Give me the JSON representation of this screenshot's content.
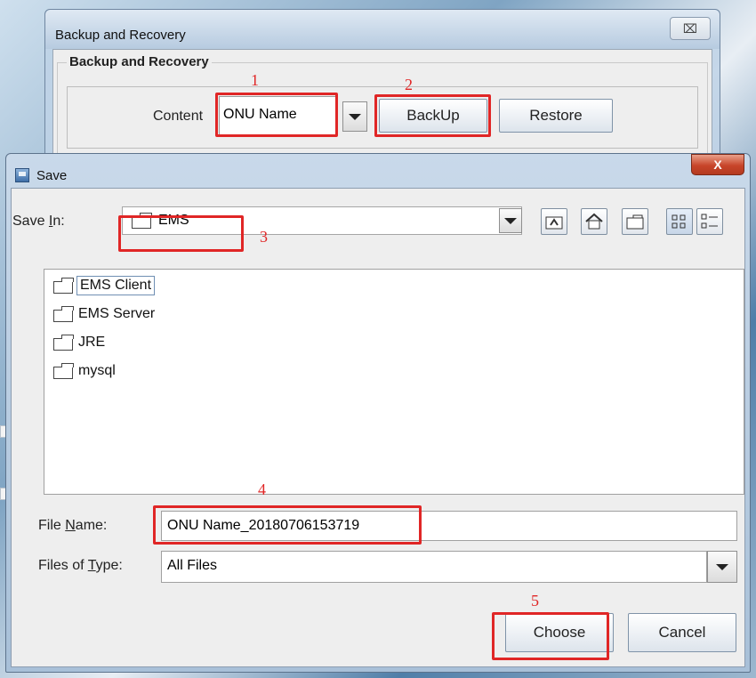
{
  "backup_window": {
    "title": "Backup and Recovery",
    "close_glyph": "⌧",
    "group_title": "Backup and Recovery",
    "content_label": "Content",
    "content_value": "ONU Name",
    "backup_button": "BackUp",
    "restore_button": "Restore"
  },
  "save_dialog": {
    "title": "Save",
    "close_glyph": "X",
    "save_in_label_prefix": "Save ",
    "save_in_label_key": "I",
    "save_in_label_suffix": "n:",
    "save_in_value": "EMS",
    "toolbar": [
      "up-one-level",
      "home",
      "new-folder",
      "list-view",
      "details-view"
    ],
    "files": [
      {
        "name": "EMS Client",
        "selected": true
      },
      {
        "name": "EMS Server",
        "selected": false
      },
      {
        "name": "JRE",
        "selected": false
      },
      {
        "name": "mysql",
        "selected": false
      }
    ],
    "file_name_label_prefix": "File ",
    "file_name_label_key": "N",
    "file_name_label_suffix": "ame:",
    "file_name_value": "ONU Name_20180706153719",
    "files_of_type_label_prefix": "Files of ",
    "files_of_type_label_key": "T",
    "files_of_type_label_suffix": "ype:",
    "files_of_type_value": "All Files",
    "choose_button": "Choose",
    "cancel_button": "Cancel"
  },
  "annotations": [
    "1",
    "2",
    "3",
    "4",
    "5"
  ],
  "colors": {
    "annotation": "#e02626"
  }
}
